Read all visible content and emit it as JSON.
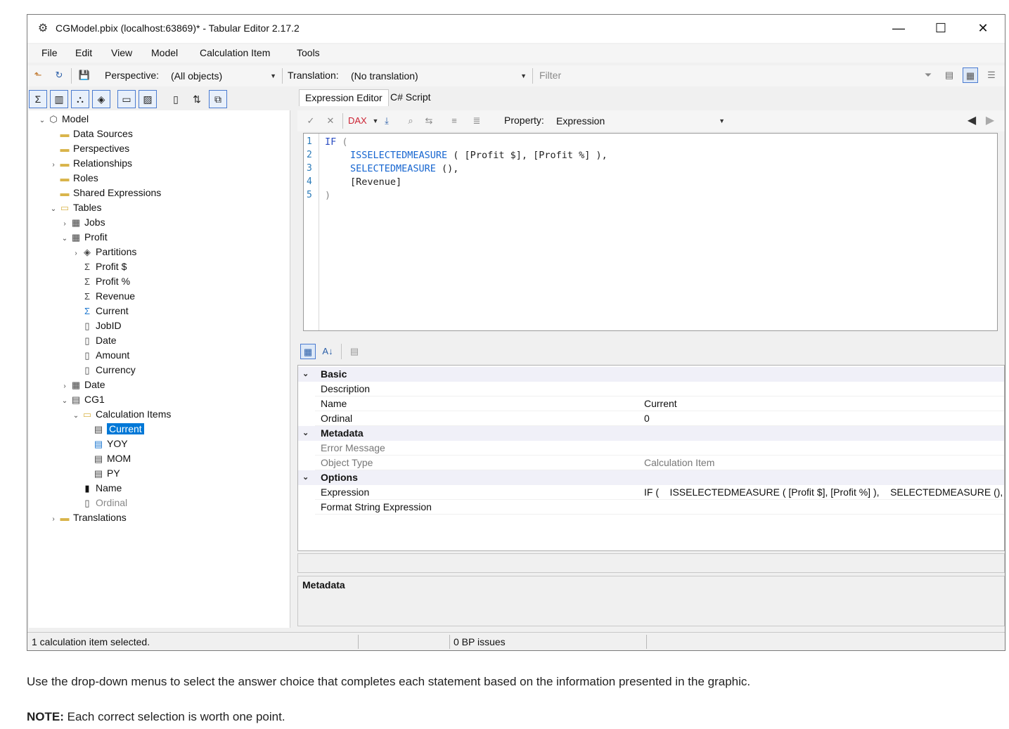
{
  "window": {
    "title": "CGModel.pbix (localhost:63869)* - Tabular Editor 2.17.2",
    "minimize": "—",
    "maximize": "☐",
    "close": "✕"
  },
  "menu": [
    "File",
    "Edit",
    "View",
    "Model",
    "Calculation Item",
    "Tools"
  ],
  "toolbar": {
    "perspective_label": "Perspective:",
    "perspective_value": "(All objects)",
    "translation_label": "Translation:",
    "translation_value": "(No translation)",
    "filter_placeholder": "Filter"
  },
  "tree": {
    "model": "Model",
    "data_sources": "Data Sources",
    "perspectives": "Perspectives",
    "relationships": "Relationships",
    "roles": "Roles",
    "shared_expressions": "Shared Expressions",
    "tables": "Tables",
    "jobs": "Jobs",
    "profit": "Profit",
    "partitions": "Partitions",
    "profit_dollar": "Profit $",
    "profit_pct": "Profit %",
    "revenue": "Revenue",
    "current": "Current",
    "jobid": "JobID",
    "date_col": "Date",
    "amount": "Amount",
    "currency": "Currency",
    "date_table": "Date",
    "cg1": "CG1",
    "calc_items": "Calculation Items",
    "item_current": "Current",
    "item_yoy": "YOY",
    "item_mom": "MOM",
    "item_py": "PY",
    "name_col": "Name",
    "ordinal_col": "Ordinal",
    "translations": "Translations"
  },
  "tabs": {
    "expression_editor": "Expression Editor",
    "csharp_script": "C# Script"
  },
  "expr_toolbar": {
    "property_label": "Property:",
    "property_value": "Expression"
  },
  "code": {
    "line_numbers": [
      "1",
      "2",
      "3",
      "4",
      "5"
    ],
    "l1_kw": "IF",
    "l1_paren": "(",
    "l2_fn": "ISSELECTEDMEASURE",
    "l2_rest": " ( [Profit $], [Profit %] ),",
    "l3_fn": "SELECTEDMEASURE",
    "l3_rest": " (),",
    "l4": "[Revenue]",
    "l5": ")"
  },
  "properties": {
    "basic": "Basic",
    "description": "Description",
    "name": "Name",
    "name_value": "Current",
    "ordinal": "Ordinal",
    "ordinal_value": "0",
    "metadata": "Metadata",
    "error_message": "Error Message",
    "object_type": "Object Type",
    "object_type_value": "Calculation Item",
    "options": "Options",
    "expression": "Expression",
    "expression_value": "IF (    ISSELECTEDMEASURE ( [Profit $], [Profit %] ),    SELECTEDMEASURE (),",
    "format_string": "Format String Expression"
  },
  "description_panel": {
    "title": "Metadata"
  },
  "status": {
    "left": "1 calculation item selected.",
    "bp": "0 BP issues"
  },
  "page": {
    "question": "Use the drop-down menus to select the answer choice that completes each statement based on the information presented in the graphic.",
    "note_label": "NOTE:",
    "note_text": " Each correct selection is worth one point."
  }
}
